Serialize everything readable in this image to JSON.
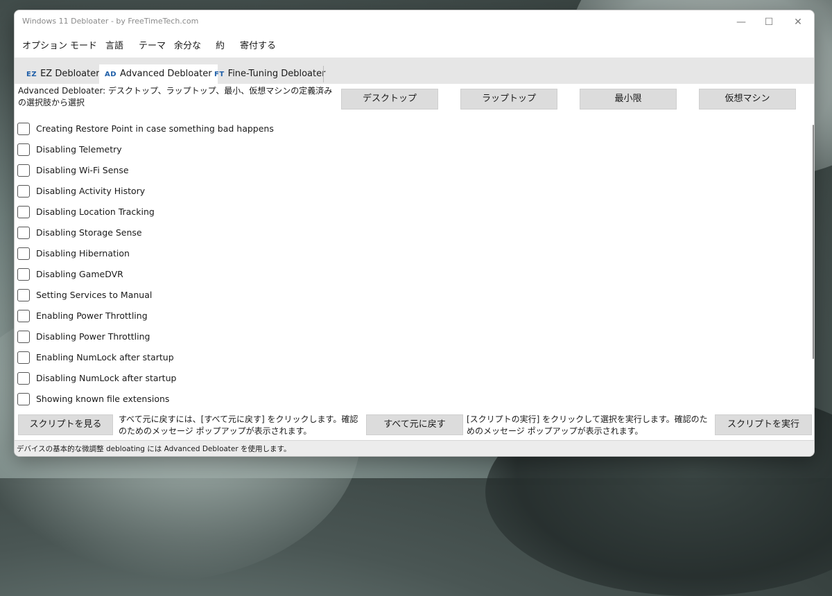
{
  "window": {
    "title": "Windows 11 Debloater - by FreeTimeTech.com",
    "minimize_glyph": "—",
    "maximize_glyph": "☐",
    "close_glyph": "✕"
  },
  "menu": [
    "オプション",
    "モード",
    "言語",
    "テーマ",
    "余分な",
    "約",
    "寄付する"
  ],
  "tabs": [
    {
      "abbr": "EZ",
      "label": "EZ Debloater",
      "active": false
    },
    {
      "abbr": "AD",
      "label": "Advanced Debloater",
      "active": true
    },
    {
      "abbr": "FT",
      "label": "Fine-Tuning Debloater",
      "active": false
    }
  ],
  "header": {
    "description": "Advanced Debloater: デスクトップ、ラップトップ、最小、仮想マシンの定義済みの選択肢から選択",
    "presets": [
      "デスクトップ",
      "ラップトップ",
      "最小限",
      "仮想マシン"
    ]
  },
  "options": [
    {
      "label": "Creating Restore Point in case something bad happens",
      "checked": false
    },
    {
      "label": "Disabling Telemetry",
      "checked": false
    },
    {
      "label": "Disabling Wi-Fi Sense",
      "checked": false
    },
    {
      "label": "Disabling Activity History",
      "checked": false
    },
    {
      "label": "Disabling Location Tracking",
      "checked": false
    },
    {
      "label": "Disabling Storage Sense",
      "checked": false
    },
    {
      "label": "Disabling Hibernation",
      "checked": false
    },
    {
      "label": "Disabling GameDVR",
      "checked": false
    },
    {
      "label": "Setting Services to Manual",
      "checked": false
    },
    {
      "label": "Enabling Power Throttling",
      "checked": false
    },
    {
      "label": "Disabling Power Throttling",
      "checked": false
    },
    {
      "label": "Enabling NumLock after startup",
      "checked": false
    },
    {
      "label": "Disabling NumLock after startup",
      "checked": false
    },
    {
      "label": "Showing known file extensions",
      "checked": false
    }
  ],
  "footer": {
    "view_script_label": "スクリプトを見る",
    "revert_note": "すべて元に戻すには、[すべて元に戻す] をクリックします。確認のためのメッセージ ポップアップが表示されます。",
    "revert_all_label": "すべて元に戻す",
    "run_note": "[スクリプトの実行] をクリックして選択を実行します。確認のためのメッセージ ポップアップが表示されます。",
    "run_script_label": "スクリプトを実行"
  },
  "status": "デバイスの基本的な微調整 debloating には Advanced Debloater を使用します。"
}
